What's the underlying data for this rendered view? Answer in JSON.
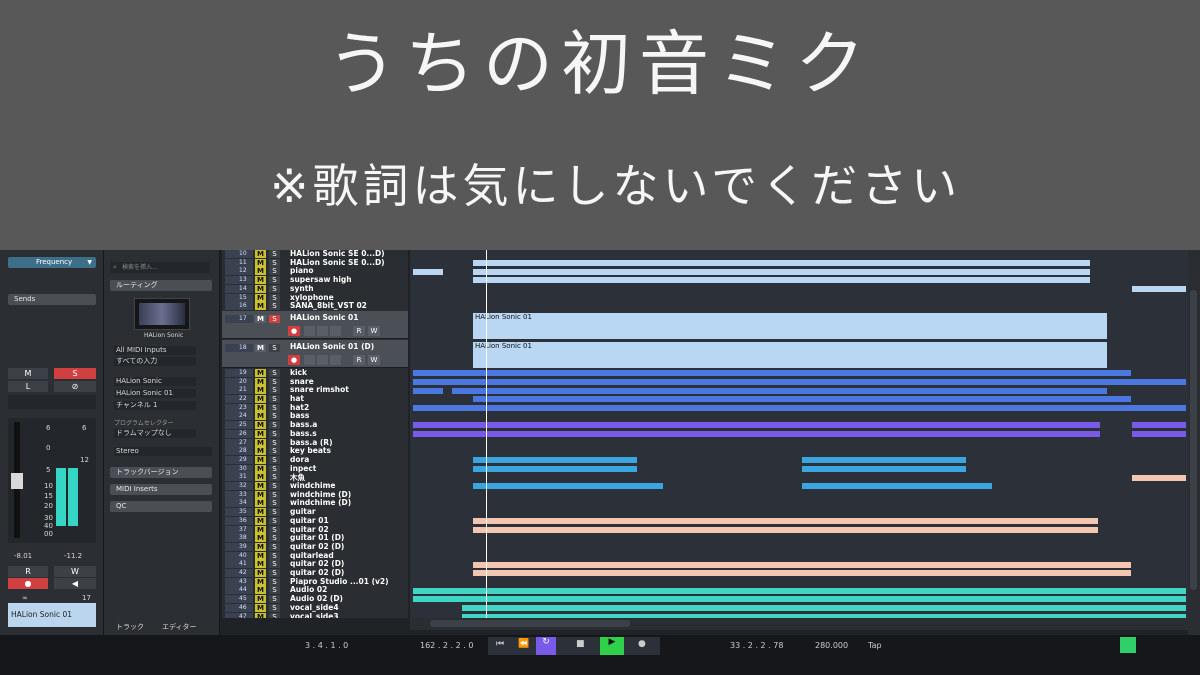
{
  "banner": {
    "title": "うちの初音ミク",
    "subtitle": "※歌詞は気にしないでください"
  },
  "inspector": {
    "frequency_label": "Frequency",
    "sends_label": "Sends",
    "m_label": "M",
    "s_label": "S",
    "l_label": "L",
    "r_label": "R",
    "w_label": "W",
    "fader_values": [
      "-8.01",
      "-11.2"
    ],
    "track_number": "17",
    "track_name": "HALion Sonic 01",
    "search_placeholder": "検索を挿入...",
    "routing_label": "ルーティング",
    "instrument_name": "HALion Sonic",
    "midi_input": "All MIDI Inputs",
    "input_all": "すべての入力",
    "output_instrument": "HALion Sonic",
    "output_track": "HALion Sonic 01",
    "channel": "チャンネル 1",
    "program_selector": "プログラムセレクター",
    "drum_map": "ドラムマップなし",
    "stereo": "Stereo",
    "track_versions": "トラックバージョン",
    "midi_inserts": "MIDI Inserts",
    "qc": "QC",
    "scale_marks": [
      "6",
      "0",
      "5",
      "10",
      "15",
      "20",
      "30",
      "40",
      "00"
    ],
    "scale_marks_right": [
      "6",
      "12"
    ],
    "tab_track": "トラック",
    "tab_editor": "エディター"
  },
  "tracks": [
    {
      "num": "10",
      "name": "HALion Sonic SE 0...D)"
    },
    {
      "num": "11",
      "name": "HALion Sonic SE 0...D)"
    },
    {
      "num": "12",
      "name": "piano"
    },
    {
      "num": "13",
      "name": "supersaw high"
    },
    {
      "num": "14",
      "name": "synth"
    },
    {
      "num": "15",
      "name": "xylophone"
    },
    {
      "num": "16",
      "name": "SANA_8bit_VST 02"
    },
    {
      "num": "17",
      "name": "HALion Sonic 01"
    },
    {
      "num": "18",
      "name": "HALion Sonic 01 (D)"
    },
    {
      "num": "19",
      "name": "kick"
    },
    {
      "num": "20",
      "name": "snare"
    },
    {
      "num": "21",
      "name": "snare rimshot"
    },
    {
      "num": "22",
      "name": "hat"
    },
    {
      "num": "23",
      "name": "hat2"
    },
    {
      "num": "24",
      "name": "bass"
    },
    {
      "num": "25",
      "name": "bass.a"
    },
    {
      "num": "26",
      "name": "bass.s"
    },
    {
      "num": "27",
      "name": "bass.a (R)"
    },
    {
      "num": "28",
      "name": "key beats"
    },
    {
      "num": "29",
      "name": "dora"
    },
    {
      "num": "30",
      "name": "inpect"
    },
    {
      "num": "31",
      "name": "木魚"
    },
    {
      "num": "32",
      "name": "windchime"
    },
    {
      "num": "33",
      "name": "windchime (D)"
    },
    {
      "num": "34",
      "name": "windchime (D)"
    },
    {
      "num": "35",
      "name": "guitar"
    },
    {
      "num": "36",
      "name": "quitar 01"
    },
    {
      "num": "37",
      "name": "quitar 02"
    },
    {
      "num": "38",
      "name": "guitar 01 (D)"
    },
    {
      "num": "39",
      "name": "quitar 02 (D)"
    },
    {
      "num": "40",
      "name": "quitarlead"
    },
    {
      "num": "41",
      "name": "quitar 02 (D)"
    },
    {
      "num": "42",
      "name": "quitar 02 (D)"
    },
    {
      "num": "43",
      "name": "Piapro Studio ...01  (v2)"
    },
    {
      "num": "44",
      "name": "Audio 02"
    },
    {
      "num": "45",
      "name": "Audio 02 (D)"
    },
    {
      "num": "46",
      "name": "vocal_side4"
    },
    {
      "num": "47",
      "name": "vocal_side3"
    }
  ],
  "track_buttons": {
    "m": "M",
    "s": "S",
    "r": "R",
    "w": "W"
  },
  "arrangement": {
    "event_label_17": "HALion Sonic 01",
    "event_label_18": "HALion Sonic 01"
  },
  "transport": {
    "left_pos": "3 . 4 . 1 . 0",
    "right_pos": "162 . 2 . 2 . 0",
    "cursor_pos": "33 . 2 . 2 . 78",
    "tempo": "280.000",
    "tap": "Tap"
  },
  "colors": {
    "light_blue": "#b9d6f2",
    "mid_blue": "#4a78e0",
    "purple": "#7a5ae8",
    "cyan": "#3aa6e0",
    "salmon": "#f2c6b0",
    "teal": "#3fd6c6",
    "yellow_m": "#c8c030",
    "red_s": "#d04040"
  }
}
